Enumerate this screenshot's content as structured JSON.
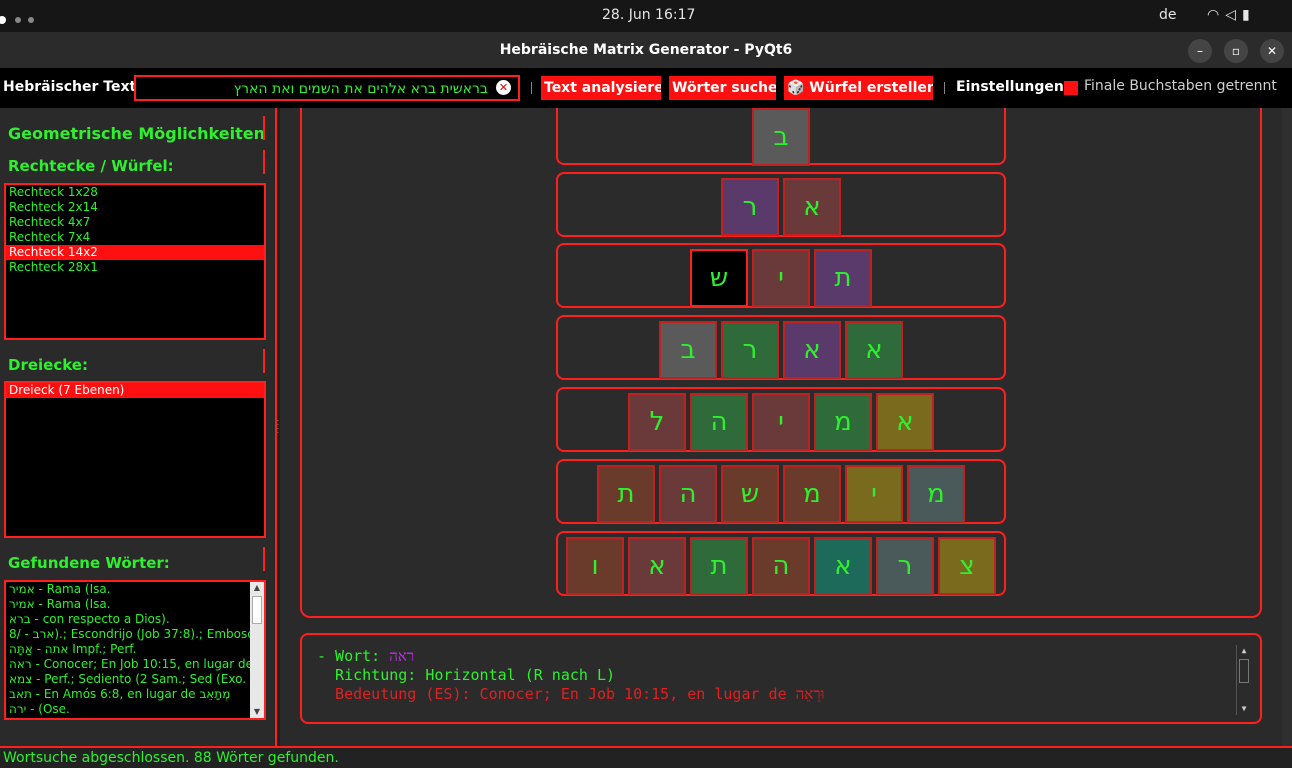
{
  "system": {
    "clock": "28. Jun  16:17",
    "language": "de",
    "tray_icons": [
      "wifi-icon",
      "volume-icon",
      "battery-icon"
    ]
  },
  "window": {
    "title": "Hebräische Matrix Generator - PyQt6",
    "minimize": "–",
    "maximize": "▫",
    "close": "✕"
  },
  "toolbar": {
    "text_label": "Hebräischer Text:",
    "text_value": "בראשית ברא אלהים את השמים ואת הארץ",
    "clear": "✕",
    "analyze_label": "Text analysieren",
    "search_label": "Wörter suchen",
    "cube_label": "🎲 Würfel erstellen...",
    "settings_label": "Einstellungen:",
    "finals_label": "Finale Buchstaben getrennt",
    "finals_checked": true
  },
  "left": {
    "geom_title": "Geometrische Möglichkeiten",
    "rect_title": "Rechtecke / Würfel:",
    "rectangles": [
      "Rechteck 1x28",
      "Rechteck 2x14",
      "Rechteck 4x7",
      "Rechteck 7x4",
      "Rechteck 14x2",
      "Rechteck 28x1"
    ],
    "rect_selected": 4,
    "tri_title": "Dreiecke:",
    "triangles": [
      "Dreieck (7 Ebenen)"
    ],
    "tri_selected": 0,
    "words_title": "Gefundene Wörter:",
    "words": [
      "אמיר - Rama (Isa.",
      "אמיר - Rama (Isa.",
      "ברא - con respecto a Dios).",
      "8/ - ארב).; Escondrijo (Job 37:8).; Embosc",
      "אתה - אַתָּה Impf.; Perf.",
      "ראה - Conocer; En Job 10:15, en lugar de",
      "צמא - Perf.; Sediento (2 Sam.; Sed (Exo.",
      "תאב - En Amós 6:8, en lugar de מְתָאֵב",
      "ירה - (Ose."
    ]
  },
  "matrix": {
    "rows": [
      {
        "cells": [
          {
            "ch": "ב",
            "color": "#5a5a5a"
          }
        ]
      },
      {
        "cells": [
          {
            "ch": "ר",
            "color": "#5a3a6a"
          },
          {
            "ch": "א",
            "color": "#6a3a3a"
          }
        ]
      },
      {
        "cells": [
          {
            "ch": "ש",
            "color": "#000000"
          },
          {
            "ch": "י",
            "color": "#6a3a3a"
          },
          {
            "ch": "ת",
            "color": "#5a3a6a"
          }
        ]
      },
      {
        "cells": [
          {
            "ch": "ב",
            "color": "#5a5a5a"
          },
          {
            "ch": "ר",
            "color": "#2e6a3a"
          },
          {
            "ch": "א",
            "color": "#5a3a6a"
          },
          {
            "ch": "א",
            "color": "#2e6a3a"
          }
        ]
      },
      {
        "cells": [
          {
            "ch": "ל",
            "color": "#6a3a3a"
          },
          {
            "ch": "ה",
            "color": "#2e6a3a"
          },
          {
            "ch": "י",
            "color": "#6a3a3a"
          },
          {
            "ch": "מ",
            "color": "#2e6a3a"
          },
          {
            "ch": "א",
            "color": "#7a6a1e"
          }
        ]
      },
      {
        "cells": [
          {
            "ch": "ת",
            "color": "#6a3a2a"
          },
          {
            "ch": "ה",
            "color": "#6a3a3a"
          },
          {
            "ch": "ש",
            "color": "#6a3a2a"
          },
          {
            "ch": "מ",
            "color": "#6a3a2a"
          },
          {
            "ch": "י",
            "color": "#7a6a1e"
          },
          {
            "ch": "מ",
            "color": "#4a5a5a"
          }
        ]
      },
      {
        "cells": [
          {
            "ch": "ו",
            "color": "#6a3a2a"
          },
          {
            "ch": "א",
            "color": "#6a3a3a"
          },
          {
            "ch": "ת",
            "color": "#2e6a3a"
          },
          {
            "ch": "ה",
            "color": "#6a3a2a"
          },
          {
            "ch": "א",
            "color": "#1e6a5a"
          },
          {
            "ch": "ר",
            "color": "#4a5a5a"
          },
          {
            "ch": "צ",
            "color": "#7a6a1e"
          }
        ]
      }
    ]
  },
  "details": {
    "word_prefix": "- Wort: ",
    "word": "ראה",
    "direction": "  Richtung: Horizontal (R nach L)",
    "meaning": "  Bedeutung (ES): Conocer; En Job 10:15, en lugar de וּרְאֵה",
    "word_color": "#c02ee0",
    "text_color": "#2ef02e",
    "meaning_color": "#e02020"
  },
  "status": "Wortsuche abgeschlossen. 88 Wörter gefunden."
}
